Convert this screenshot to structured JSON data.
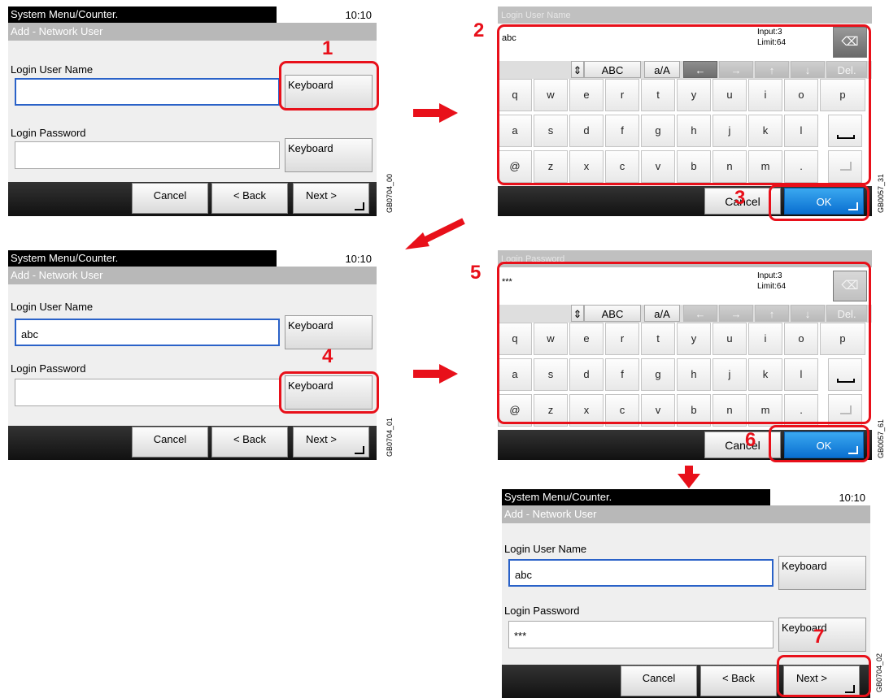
{
  "common": {
    "title": "System Menu/Counter.",
    "time": "10:10",
    "subtitle": "Add - Network User",
    "login_user_label": "Login User Name",
    "login_password_label": "Login Password",
    "keyboard_label": "Keyboard",
    "cancel_label": "Cancel",
    "back_label": "< Back",
    "next_label": "Next >"
  },
  "screen1": {
    "user_value": "",
    "password_value": "",
    "code": "GB0704_00"
  },
  "screen2": {
    "user_value": "abc",
    "password_value": "",
    "code": "GB0704_01"
  },
  "screen3": {
    "user_value": "abc",
    "password_value": "***",
    "code": "GB0704_02"
  },
  "keyboard_common": {
    "input_count": "Input:3",
    "limit": "Limit:64",
    "mode_abc": "ABC",
    "mode_case": "a/A",
    "del_label": "Del.",
    "ok_label": "OK",
    "cancel_label": "Cancel",
    "row1": [
      "q",
      "w",
      "e",
      "r",
      "t",
      "y",
      "u",
      "i",
      "o",
      "p"
    ],
    "row2": [
      "a",
      "s",
      "d",
      "f",
      "g",
      "h",
      "j",
      "k",
      "l"
    ],
    "row3": [
      "@",
      "z",
      "x",
      "c",
      "v",
      "b",
      "n",
      "m",
      "."
    ]
  },
  "keyboard1": {
    "header": "Login User Name",
    "text": "abc",
    "code": "GB0057_31"
  },
  "keyboard2": {
    "header": "Login Password",
    "text": "***",
    "code": "GB0057_61"
  },
  "steps": [
    "1",
    "2",
    "3",
    "4",
    "5",
    "6",
    "7"
  ],
  "colors": {
    "highlight": "#e8101a",
    "ok_blue": "#1a8ae0",
    "focus_border": "#2a62c8"
  }
}
